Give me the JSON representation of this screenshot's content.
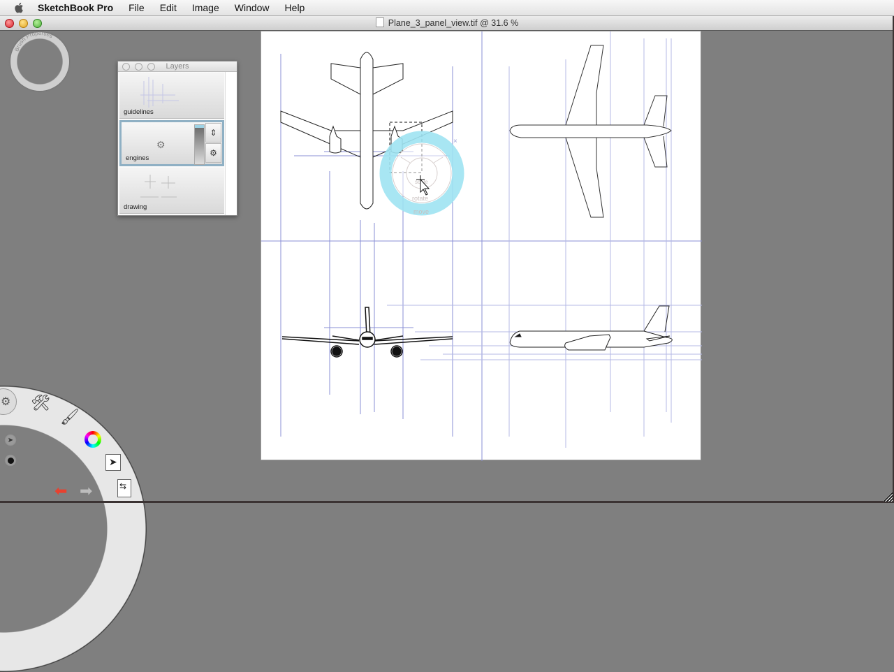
{
  "menubar": {
    "apple_icon": "apple-logo",
    "app_name": "SketchBook Pro",
    "items": [
      "File",
      "Edit",
      "Image",
      "Window",
      "Help"
    ]
  },
  "window": {
    "title": "Plane_3_panel_view.tif @ 31.6 %",
    "file_name": "Plane_3_panel_view.tif",
    "zoom_level": "31.6 %"
  },
  "brush_puck": {
    "label": "Brush Properties"
  },
  "layers_panel": {
    "title": "Layers",
    "layers": [
      {
        "name": "guidelines",
        "selected": false
      },
      {
        "name": "engines",
        "selected": true
      },
      {
        "name": "drawing",
        "selected": false
      }
    ],
    "buttons": {
      "move_icon": "move-layer-icon",
      "transform_icon": "transform-icon"
    }
  },
  "transform_puck": {
    "labels": [
      "scale",
      "rotate",
      "move"
    ],
    "close_glyph": "×",
    "accent_color": "#9fe3f2"
  },
  "lagoon": {
    "icons": [
      "settings-icon",
      "tools-icon",
      "brush-icon",
      "color-wheel-icon",
      "select-icon",
      "layer-swap-icon"
    ],
    "undo_icon": "undo-icon",
    "redo_icon": "redo-icon",
    "undo_color": "#e8412f"
  },
  "canvas": {
    "panels": [
      "top-view",
      "front-view-top-right",
      "front-view",
      "side-view"
    ],
    "guide_color": "#8a8fd6"
  }
}
